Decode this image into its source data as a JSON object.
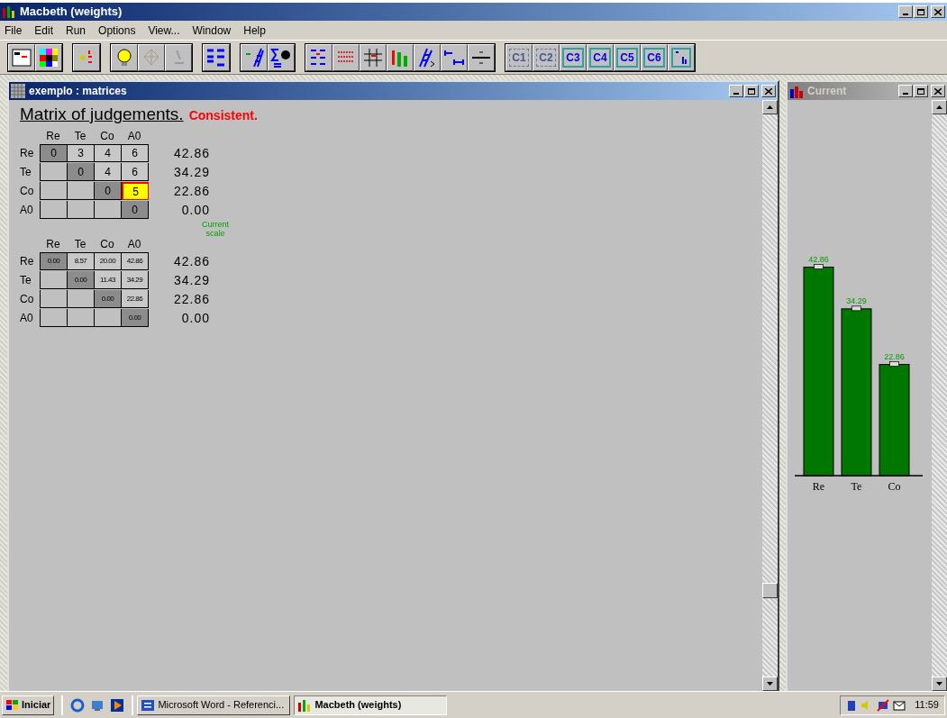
{
  "window": {
    "title": "Macbeth (weights)"
  },
  "menu": [
    "File",
    "Edit",
    "Run",
    "Options",
    "View...",
    "Window",
    "Help"
  ],
  "toolbar_cuts": [
    {
      "label": "C1",
      "disabled": true
    },
    {
      "label": "C2",
      "disabled": true
    },
    {
      "label": "C3",
      "disabled": false
    },
    {
      "label": "C4",
      "disabled": false
    },
    {
      "label": "C5",
      "disabled": false
    },
    {
      "label": "C6",
      "disabled": false
    }
  ],
  "matrix_window": {
    "title": "exemplo : matrices",
    "active": true,
    "heading": "Matrix of judgements.",
    "status": "Consistent.",
    "judgements": {
      "columns": [
        "Re",
        "Te",
        "Co",
        "A0"
      ],
      "rows": [
        {
          "label": "Re",
          "cells": [
            {
              "value": "0",
              "selected": false
            },
            {
              "value": "3",
              "selected": false
            },
            {
              "value": "4",
              "selected": false
            },
            {
              "value": "6",
              "selected": false
            }
          ],
          "score": "42.86"
        },
        {
          "label": "Te",
          "cells": [
            {
              "selected": false
            },
            {
              "value": "0",
              "selected": false
            },
            {
              "value": "4",
              "selected": false
            },
            {
              "value": "6",
              "selected": false
            }
          ],
          "score": "34.29"
        },
        {
          "label": "Co",
          "cells": [
            {
              "selected": false
            },
            {
              "selected": false
            },
            {
              "value": "0",
              "selected": false
            },
            {
              "value": "5",
              "selected": true
            }
          ],
          "score": "22.86"
        },
        {
          "label": "A0",
          "cells": [
            {
              "selected": false
            },
            {
              "selected": false
            },
            {
              "selected": false
            },
            {
              "value": "0",
              "selected": false
            }
          ],
          "score": "0.00"
        }
      ]
    },
    "scale_label": "Current scale",
    "differences": {
      "columns": [
        "Re",
        "Te",
        "Co",
        "A0"
      ],
      "rows": [
        {
          "label": "Re",
          "cells": [
            "0.00",
            "8.57",
            "20.00",
            "42.86"
          ],
          "score": "42.86"
        },
        {
          "label": "Te",
          "cells": [
            "",
            "0.00",
            "11.43",
            "34.29"
          ],
          "score": "34.29"
        },
        {
          "label": "Co",
          "cells": [
            "",
            "",
            "0.00",
            "22.86"
          ],
          "score": "22.86"
        },
        {
          "label": "A0",
          "cells": [
            "",
            "",
            "",
            "0.00"
          ],
          "score": "0.00"
        }
      ]
    }
  },
  "chart_window": {
    "title": "Current",
    "active": false,
    "chart_data": {
      "type": "bar",
      "categories": [
        "Re",
        "Te",
        "Co"
      ],
      "values": [
        42.86,
        34.29,
        22.86
      ],
      "data_labels": true
    }
  },
  "taskbar": {
    "start": "Iniciar",
    "tasks": [
      {
        "label": "Microsoft Word - Referenci...",
        "selected": false
      },
      {
        "label": "Macbeth (weights)",
        "selected": true
      }
    ],
    "clock": "11:59"
  }
}
